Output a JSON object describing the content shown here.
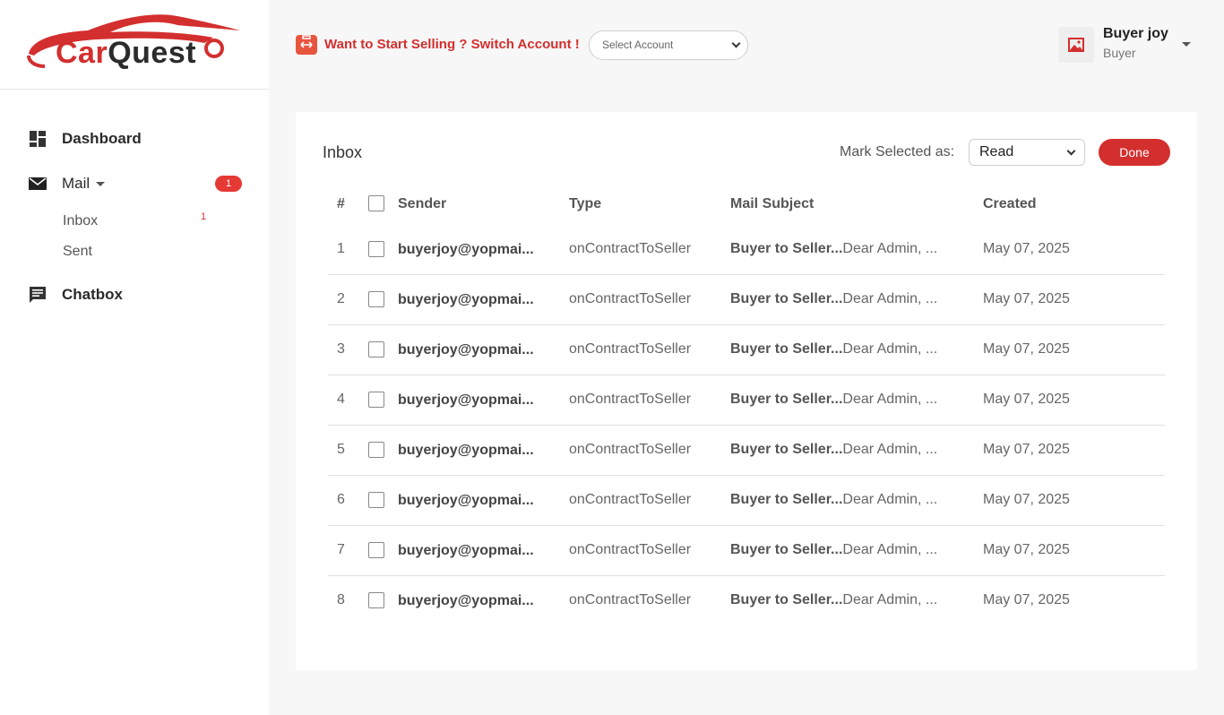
{
  "brand": {
    "name_part1": "Car",
    "name_part2": "Quest",
    "accent": "#d32f2f"
  },
  "sidebar": {
    "items": [
      {
        "label": "Dashboard",
        "icon": "dashboard-icon"
      },
      {
        "label": "Mail",
        "icon": "mail-icon",
        "badge": "1"
      },
      {
        "label": "Chatbox",
        "icon": "chat-icon"
      }
    ],
    "mail_sub": [
      {
        "label": "Inbox",
        "count": "1"
      },
      {
        "label": "Sent"
      }
    ]
  },
  "topbar": {
    "switch_text": "Want to Start Selling ? Switch Account !",
    "select_account": "Select Account",
    "user_name": "Buyer joy",
    "user_role": "Buyer"
  },
  "inbox": {
    "title": "Inbox",
    "mark_label": "Mark Selected as:",
    "mark_value": "Read",
    "done_label": "Done",
    "headers": {
      "num": "#",
      "sender": "Sender",
      "type": "Type",
      "subject": "Mail Subject",
      "created": "Created"
    },
    "rows": [
      {
        "num": "1",
        "sender": "buyerjoy@yopmai...",
        "type": "onContractToSeller",
        "subject_bold": "Buyer to Seller...",
        "subject_rest": "Dear Admin, ...",
        "created": "May 07, 2025"
      },
      {
        "num": "2",
        "sender": "buyerjoy@yopmai...",
        "type": "onContractToSeller",
        "subject_bold": "Buyer to Seller...",
        "subject_rest": "Dear Admin, ...",
        "created": "May 07, 2025"
      },
      {
        "num": "3",
        "sender": "buyerjoy@yopmai...",
        "type": "onContractToSeller",
        "subject_bold": "Buyer to Seller...",
        "subject_rest": "Dear Admin, ...",
        "created": "May 07, 2025"
      },
      {
        "num": "4",
        "sender": "buyerjoy@yopmai...",
        "type": "onContractToSeller",
        "subject_bold": "Buyer to Seller...",
        "subject_rest": "Dear Admin, ...",
        "created": "May 07, 2025"
      },
      {
        "num": "5",
        "sender": "buyerjoy@yopmai...",
        "type": "onContractToSeller",
        "subject_bold": "Buyer to Seller...",
        "subject_rest": "Dear Admin, ...",
        "created": "May 07, 2025"
      },
      {
        "num": "6",
        "sender": "buyerjoy@yopmai...",
        "type": "onContractToSeller",
        "subject_bold": "Buyer to Seller...",
        "subject_rest": "Dear Admin, ...",
        "created": "May 07, 2025"
      },
      {
        "num": "7",
        "sender": "buyerjoy@yopmai...",
        "type": "onContractToSeller",
        "subject_bold": "Buyer to Seller...",
        "subject_rest": "Dear Admin, ...",
        "created": "May 07, 2025"
      },
      {
        "num": "8",
        "sender": "buyerjoy@yopmai...",
        "type": "onContractToSeller",
        "subject_bold": "Buyer to Seller...",
        "subject_rest": "Dear Admin, ...",
        "created": "May 07, 2025"
      }
    ]
  }
}
